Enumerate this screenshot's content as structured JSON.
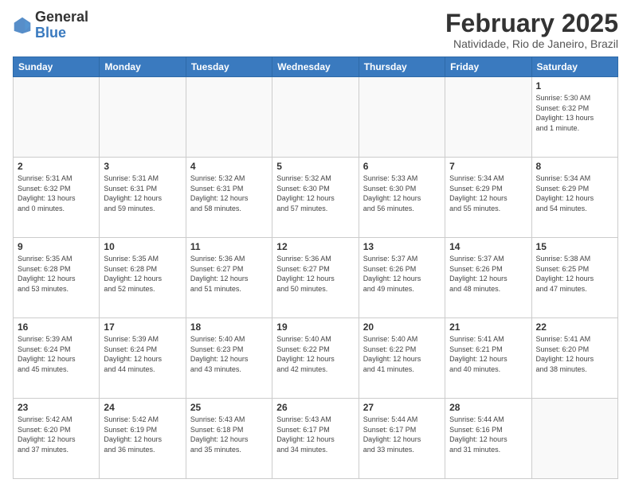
{
  "header": {
    "logo_general": "General",
    "logo_blue": "Blue",
    "month_title": "February 2025",
    "location": "Natividade, Rio de Janeiro, Brazil"
  },
  "weekdays": [
    "Sunday",
    "Monday",
    "Tuesday",
    "Wednesday",
    "Thursday",
    "Friday",
    "Saturday"
  ],
  "weeks": [
    [
      {
        "day": "",
        "info": ""
      },
      {
        "day": "",
        "info": ""
      },
      {
        "day": "",
        "info": ""
      },
      {
        "day": "",
        "info": ""
      },
      {
        "day": "",
        "info": ""
      },
      {
        "day": "",
        "info": ""
      },
      {
        "day": "1",
        "info": "Sunrise: 5:30 AM\nSunset: 6:32 PM\nDaylight: 13 hours\nand 1 minute."
      }
    ],
    [
      {
        "day": "2",
        "info": "Sunrise: 5:31 AM\nSunset: 6:32 PM\nDaylight: 13 hours\nand 0 minutes."
      },
      {
        "day": "3",
        "info": "Sunrise: 5:31 AM\nSunset: 6:31 PM\nDaylight: 12 hours\nand 59 minutes."
      },
      {
        "day": "4",
        "info": "Sunrise: 5:32 AM\nSunset: 6:31 PM\nDaylight: 12 hours\nand 58 minutes."
      },
      {
        "day": "5",
        "info": "Sunrise: 5:32 AM\nSunset: 6:30 PM\nDaylight: 12 hours\nand 57 minutes."
      },
      {
        "day": "6",
        "info": "Sunrise: 5:33 AM\nSunset: 6:30 PM\nDaylight: 12 hours\nand 56 minutes."
      },
      {
        "day": "7",
        "info": "Sunrise: 5:34 AM\nSunset: 6:29 PM\nDaylight: 12 hours\nand 55 minutes."
      },
      {
        "day": "8",
        "info": "Sunrise: 5:34 AM\nSunset: 6:29 PM\nDaylight: 12 hours\nand 54 minutes."
      }
    ],
    [
      {
        "day": "9",
        "info": "Sunrise: 5:35 AM\nSunset: 6:28 PM\nDaylight: 12 hours\nand 53 minutes."
      },
      {
        "day": "10",
        "info": "Sunrise: 5:35 AM\nSunset: 6:28 PM\nDaylight: 12 hours\nand 52 minutes."
      },
      {
        "day": "11",
        "info": "Sunrise: 5:36 AM\nSunset: 6:27 PM\nDaylight: 12 hours\nand 51 minutes."
      },
      {
        "day": "12",
        "info": "Sunrise: 5:36 AM\nSunset: 6:27 PM\nDaylight: 12 hours\nand 50 minutes."
      },
      {
        "day": "13",
        "info": "Sunrise: 5:37 AM\nSunset: 6:26 PM\nDaylight: 12 hours\nand 49 minutes."
      },
      {
        "day": "14",
        "info": "Sunrise: 5:37 AM\nSunset: 6:26 PM\nDaylight: 12 hours\nand 48 minutes."
      },
      {
        "day": "15",
        "info": "Sunrise: 5:38 AM\nSunset: 6:25 PM\nDaylight: 12 hours\nand 47 minutes."
      }
    ],
    [
      {
        "day": "16",
        "info": "Sunrise: 5:39 AM\nSunset: 6:24 PM\nDaylight: 12 hours\nand 45 minutes."
      },
      {
        "day": "17",
        "info": "Sunrise: 5:39 AM\nSunset: 6:24 PM\nDaylight: 12 hours\nand 44 minutes."
      },
      {
        "day": "18",
        "info": "Sunrise: 5:40 AM\nSunset: 6:23 PM\nDaylight: 12 hours\nand 43 minutes."
      },
      {
        "day": "19",
        "info": "Sunrise: 5:40 AM\nSunset: 6:22 PM\nDaylight: 12 hours\nand 42 minutes."
      },
      {
        "day": "20",
        "info": "Sunrise: 5:40 AM\nSunset: 6:22 PM\nDaylight: 12 hours\nand 41 minutes."
      },
      {
        "day": "21",
        "info": "Sunrise: 5:41 AM\nSunset: 6:21 PM\nDaylight: 12 hours\nand 40 minutes."
      },
      {
        "day": "22",
        "info": "Sunrise: 5:41 AM\nSunset: 6:20 PM\nDaylight: 12 hours\nand 38 minutes."
      }
    ],
    [
      {
        "day": "23",
        "info": "Sunrise: 5:42 AM\nSunset: 6:20 PM\nDaylight: 12 hours\nand 37 minutes."
      },
      {
        "day": "24",
        "info": "Sunrise: 5:42 AM\nSunset: 6:19 PM\nDaylight: 12 hours\nand 36 minutes."
      },
      {
        "day": "25",
        "info": "Sunrise: 5:43 AM\nSunset: 6:18 PM\nDaylight: 12 hours\nand 35 minutes."
      },
      {
        "day": "26",
        "info": "Sunrise: 5:43 AM\nSunset: 6:17 PM\nDaylight: 12 hours\nand 34 minutes."
      },
      {
        "day": "27",
        "info": "Sunrise: 5:44 AM\nSunset: 6:17 PM\nDaylight: 12 hours\nand 33 minutes."
      },
      {
        "day": "28",
        "info": "Sunrise: 5:44 AM\nSunset: 6:16 PM\nDaylight: 12 hours\nand 31 minutes."
      },
      {
        "day": "",
        "info": ""
      }
    ]
  ]
}
